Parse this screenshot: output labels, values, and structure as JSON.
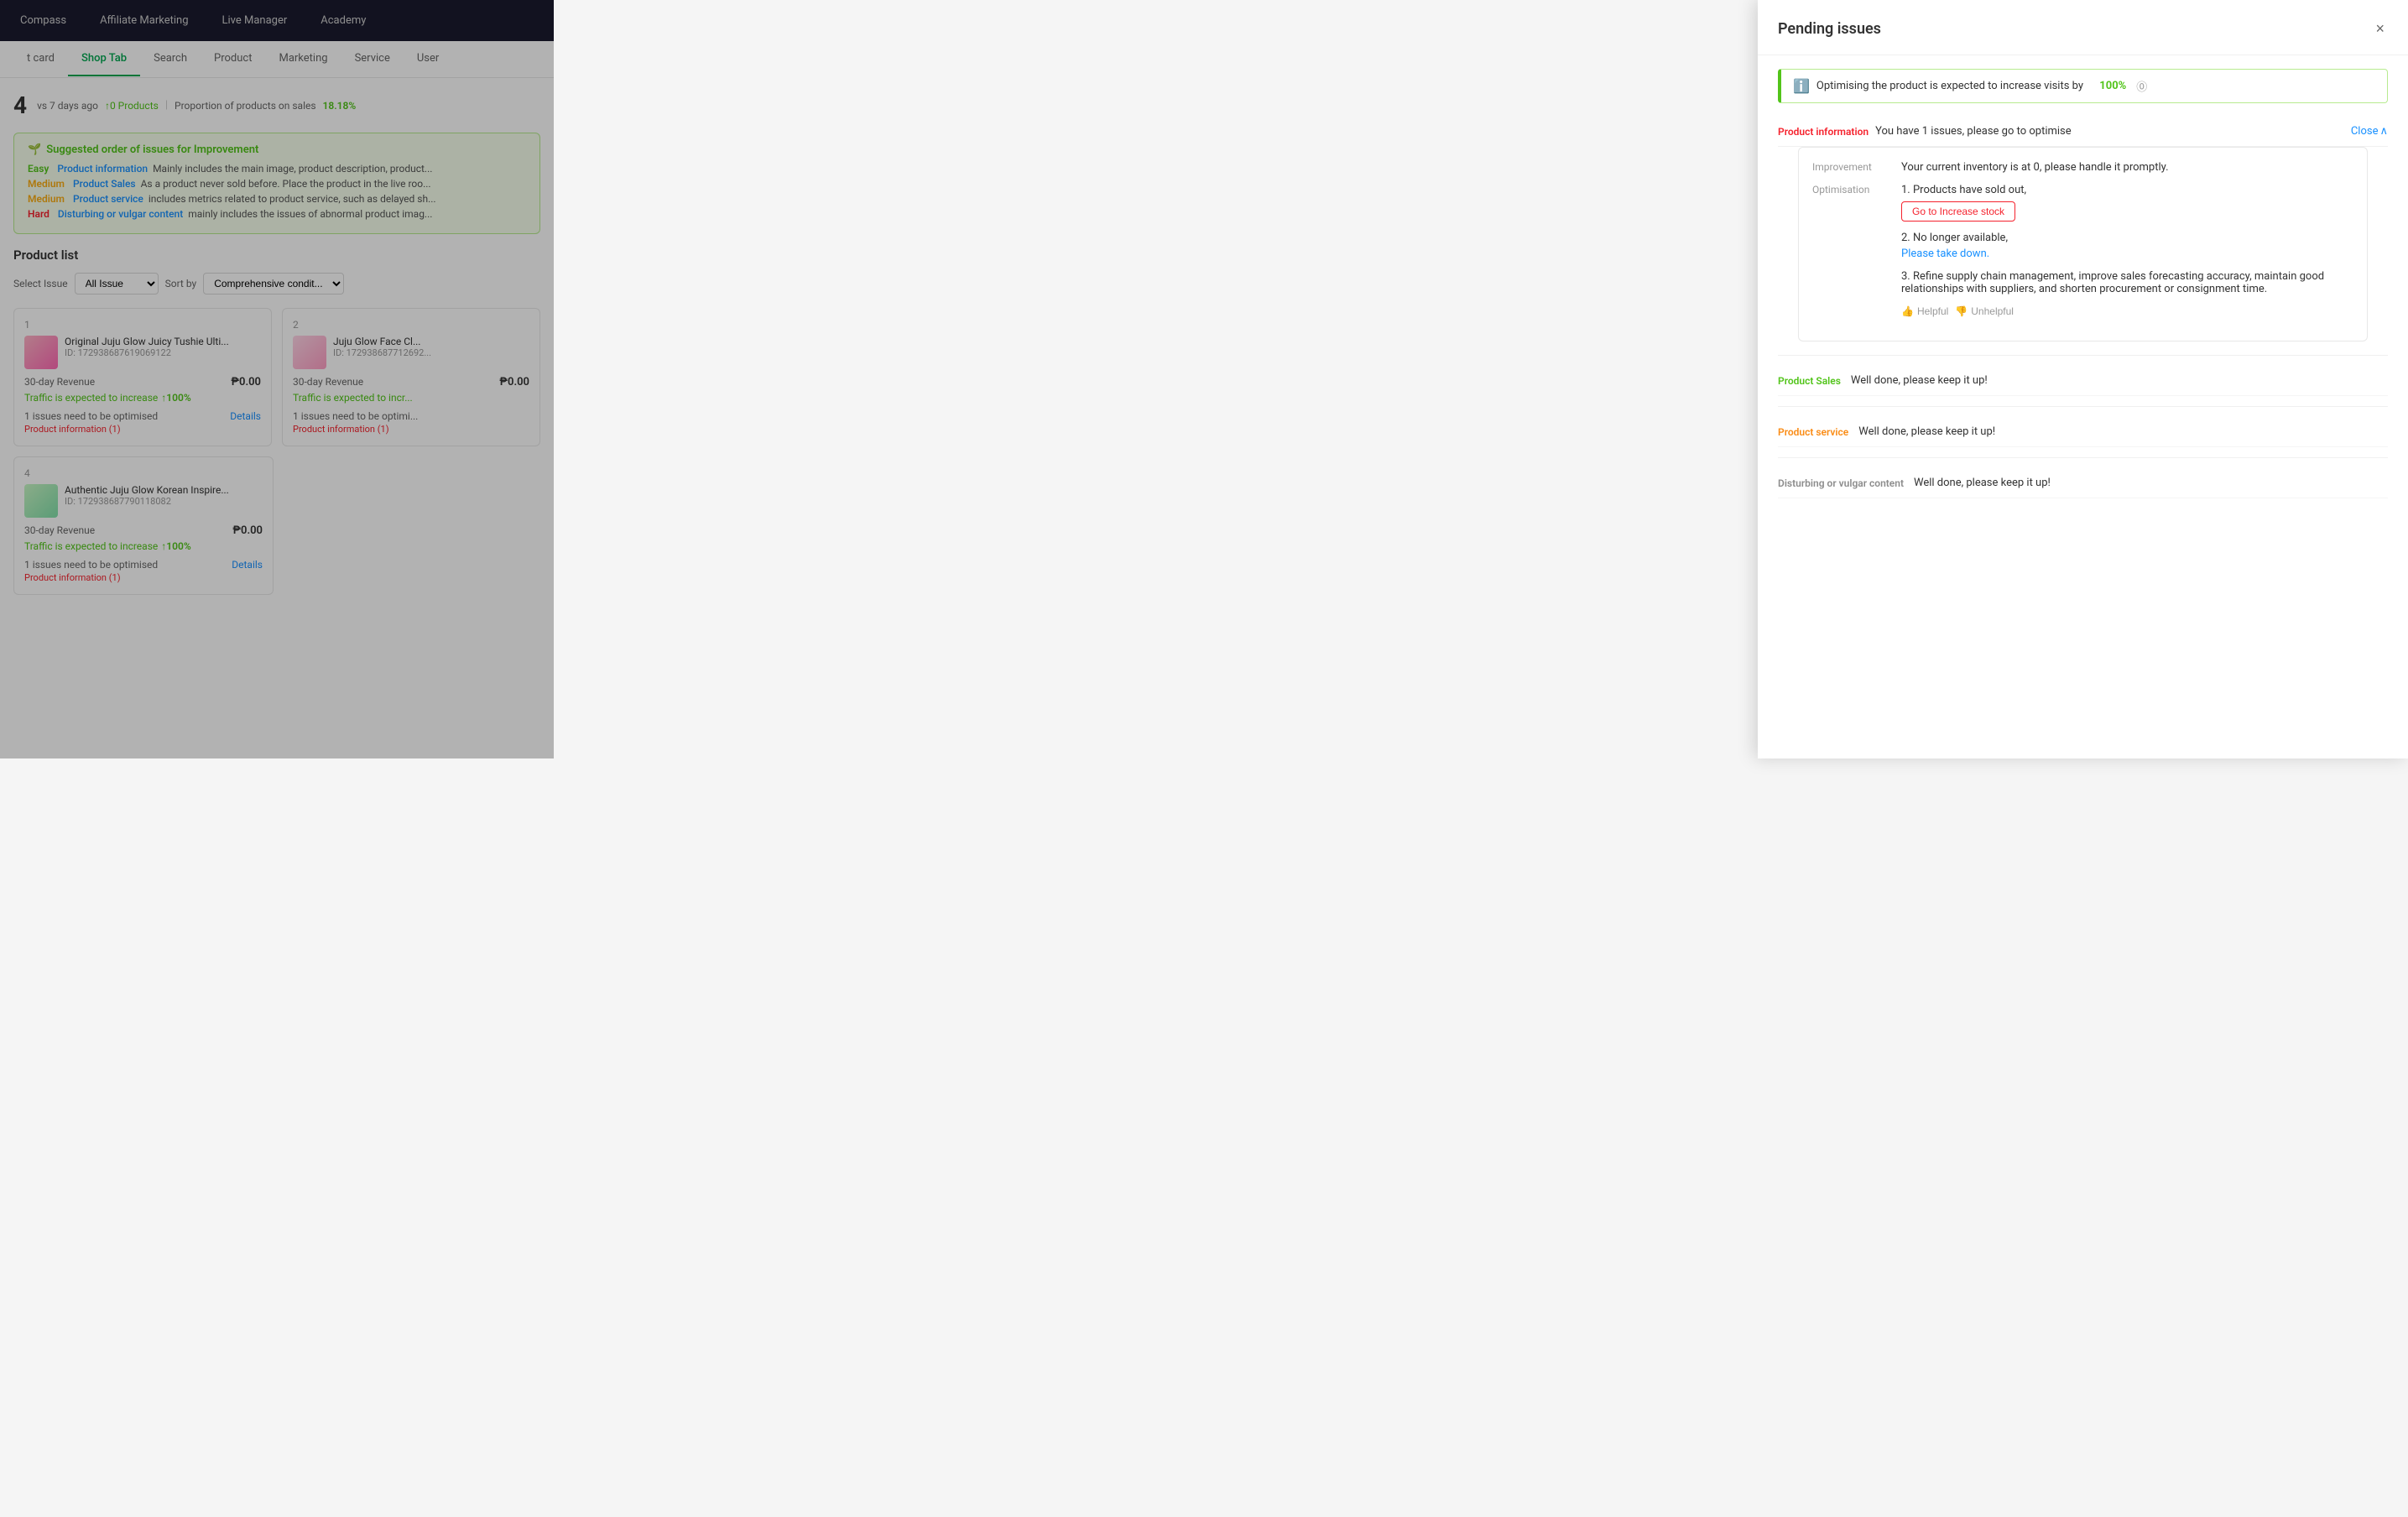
{
  "nav": {
    "items": [
      {
        "label": "Compass",
        "active": false
      },
      {
        "label": "Affiliate Marketing",
        "active": false
      },
      {
        "label": "Live Manager",
        "active": false
      },
      {
        "label": "Academy",
        "active": false
      }
    ]
  },
  "tabs": {
    "items": [
      {
        "label": "t card",
        "active": false
      },
      {
        "label": "Shop Tab",
        "active": true
      },
      {
        "label": "Search",
        "active": false
      },
      {
        "label": "Product",
        "active": false
      },
      {
        "label": "Marketing",
        "active": false
      },
      {
        "label": "Service",
        "active": false
      },
      {
        "label": "User",
        "active": false
      }
    ]
  },
  "stats": {
    "number": "4",
    "vs_label": "vs 7 days ago",
    "products_label": "↑0 Products",
    "separator": "|",
    "proportion_label": "Proportion of products on sales",
    "proportion_value": "18.18%"
  },
  "suggestion_box": {
    "title": "Suggested order of issues for Improvement",
    "rows": [
      {
        "difficulty": "Easy",
        "category": "Product information",
        "text": "Mainly includes the main image, product description, product..."
      },
      {
        "difficulty": "Medium",
        "category": "Product Sales",
        "text": "As a product never sold before. Place the product in the live roo..."
      },
      {
        "difficulty": "Medium",
        "category": "Product service",
        "text": "includes metrics related to product service, such as delayed sh..."
      },
      {
        "difficulty": "Hard",
        "category": "Disturbing or vulgar content",
        "text": "mainly includes the issues of abnormal product imag..."
      }
    ]
  },
  "product_list": {
    "title": "Product list",
    "filter_label": "Select Issue",
    "filter_value": "All Issue",
    "sort_label": "Sort by",
    "sort_value": "Comprehensive condit...",
    "products": [
      {
        "num": "1",
        "name": "Original Juju Glow Juicy Tushie Ulti...",
        "id": "ID: 172938687619069122",
        "revenue_label": "30-day Revenue",
        "revenue_amount": "₱0.00",
        "traffic_label": "Traffic is expected to increase",
        "traffic_pct": "↑100%",
        "issues_label": "1 issues need to be optimised",
        "details_label": "Details",
        "tag_label": "Product information (1)"
      },
      {
        "num": "2",
        "name": "Juju Glow Face Cl...",
        "id": "ID: 172938687712692...",
        "revenue_label": "30-day Revenue",
        "revenue_amount": "₱0.00",
        "traffic_label": "Traffic is expected to incr...",
        "traffic_pct": "↑...",
        "issues_label": "1 issues need to be optimi...",
        "details_label": "Details",
        "tag_label": "Product information (1)"
      },
      {
        "num": "4",
        "name": "Authentic Juju Glow Korean Inspire...",
        "id": "ID: 172938687790118082",
        "revenue_label": "30-day Revenue",
        "revenue_amount": "₱0.00",
        "traffic_label": "Traffic is expected to increase",
        "traffic_pct": "↑100%",
        "issues_label": "1 issues need to be optimised",
        "details_label": "Details",
        "tag_label": "Product information (1)"
      }
    ]
  },
  "panel": {
    "title": "Pending issues",
    "close_label": "×",
    "info_banner": {
      "text": "Optimising the product is expected to increase visits by",
      "pct": "100%"
    },
    "sections": [
      {
        "tag": "Product information",
        "tag_color": "red",
        "message": "You have 1 issues, please go to optimise",
        "close_label": "Close",
        "expanded": true,
        "detail": {
          "improvement_label": "Improvement",
          "improvement_text": "Your current inventory is at 0, please handle it promptly.",
          "optimisation_label": "Optimisation",
          "items": [
            {
              "text": "1. Products have sold out,",
              "action_label": "Go to Increase stock",
              "action_type": "button"
            },
            {
              "text": "2. No longer available,",
              "action_label": "Please take down.",
              "action_type": "link"
            },
            {
              "text": "3. Refine supply chain management, improve sales forecasting accuracy, maintain good relationships with suppliers, and shorten procurement or consignment time.",
              "action_type": "none"
            }
          ],
          "helpful_label": "Helpful",
          "unhelpful_label": "Unhelpful"
        }
      },
      {
        "tag": "Product Sales",
        "tag_color": "green",
        "message": "Well done, please keep it up!",
        "expanded": false
      },
      {
        "tag": "Product service",
        "tag_color": "orange",
        "message": "Well done, please keep it up!",
        "expanded": false
      },
      {
        "tag": "Disturbing or vulgar content",
        "tag_color": "gray",
        "message": "Well done, please keep it up!",
        "expanded": false
      }
    ]
  }
}
